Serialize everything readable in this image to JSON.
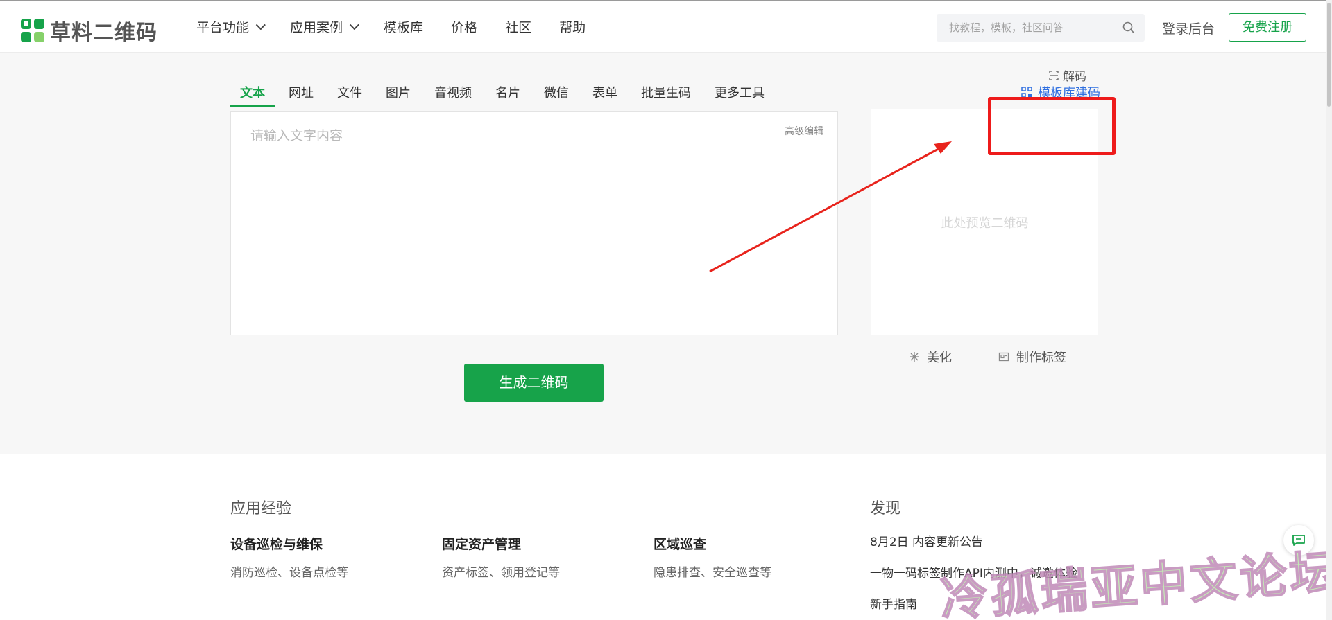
{
  "header": {
    "logo_text": "草料二维码",
    "nav": [
      {
        "label": "平台功能",
        "has_dropdown": true
      },
      {
        "label": "应用案例",
        "has_dropdown": true
      },
      {
        "label": "模板库",
        "has_dropdown": false
      },
      {
        "label": "价格",
        "has_dropdown": false
      },
      {
        "label": "社区",
        "has_dropdown": false
      },
      {
        "label": "帮助",
        "has_dropdown": false
      }
    ],
    "search_placeholder": "找教程，模板，社区问答",
    "login_label": "登录后台",
    "register_label": "免费注册"
  },
  "generator": {
    "tabs": [
      "文本",
      "网址",
      "文件",
      "图片",
      "音视频",
      "名片",
      "微信",
      "表单",
      "批量生码",
      "更多工具"
    ],
    "active_tab": "文本",
    "template_link": "模板库建码",
    "input_placeholder": "请输入文字内容",
    "advanced_edit": "高级编辑",
    "generate_button": "生成二维码",
    "preview_placeholder": "此处预览二维码",
    "decode_label": "解码",
    "beautify_label": "美化",
    "label_maker": "制作标签"
  },
  "lower": {
    "section_experience": "应用经验",
    "cases": [
      {
        "title": "设备巡检与维保",
        "desc": "消防巡检、设备点检等"
      },
      {
        "title": "固定资产管理",
        "desc": "资产标签、领用登记等"
      },
      {
        "title": "区域巡查",
        "desc": "隐患排查、安全巡查等"
      }
    ],
    "section_discover": "发现",
    "news": [
      "8月2日 内容更新公告",
      "一物一码标签制作API内测中，诚邀体验",
      "新手指南"
    ]
  },
  "overlay": {
    "watermark": "冷孤瑞亚中文论坛",
    "annotation_color": "#ee1b1b"
  },
  "colors": {
    "brand_green": "#16a34a",
    "link_blue": "#2f6fe0"
  }
}
